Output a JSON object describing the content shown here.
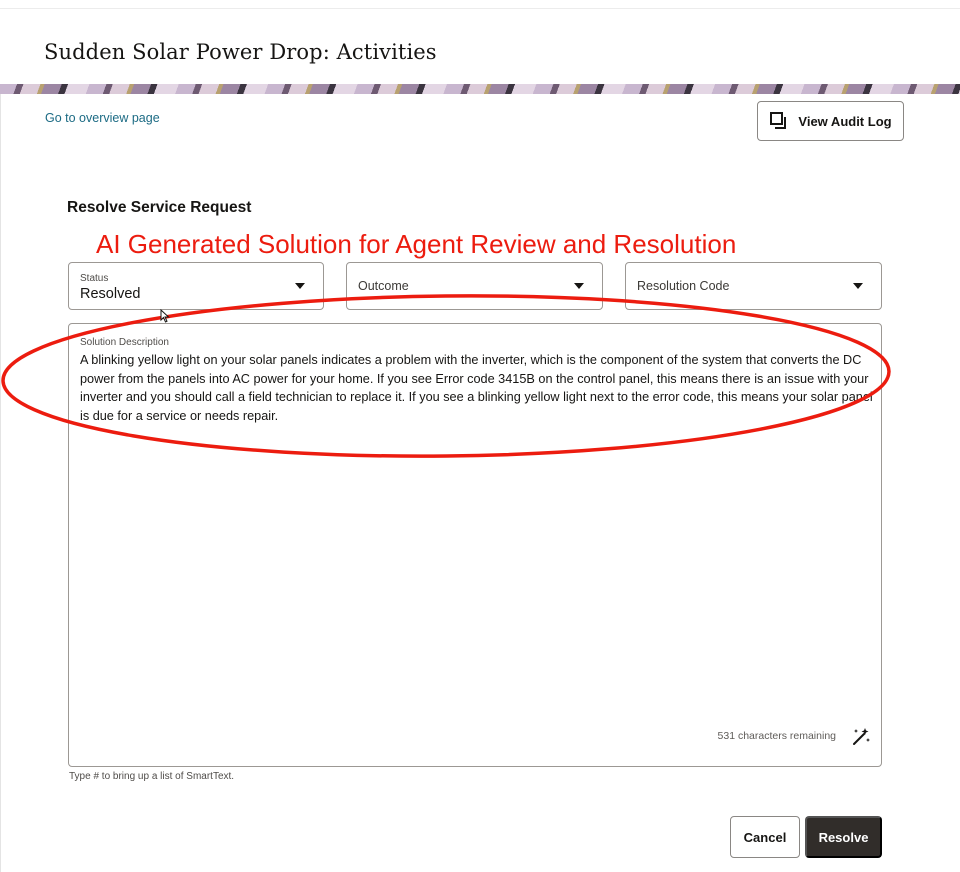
{
  "header": {
    "title": "Sudden Solar Power Drop: Activities"
  },
  "toolbar": {
    "overview_link": "Go to overview page",
    "audit_log_label": "View Audit Log"
  },
  "form": {
    "title": "Resolve Service Request",
    "annotation": "AI Generated Solution for Agent Review and Resolution",
    "status": {
      "label": "Status",
      "value": "Resolved"
    },
    "outcome": {
      "label": "Outcome"
    },
    "resolution_code": {
      "label": "Resolution Code"
    },
    "solution": {
      "label": "Solution Description",
      "text": "A blinking yellow light on your solar panels indicates a problem with the inverter, which is the component of the system that converts the DC power from the panels into AC power for your home. If you see Error code 3415B on the control panel, this means there is an issue with your inverter and you should call a field technician to replace it. If you see a blinking yellow light next to the error code, this means your solar panel is due for a service or needs repair.",
      "chars_remaining": "531 characters remaining"
    },
    "helper": "Type # to bring up a list of SmartText.",
    "cancel_label": "Cancel",
    "resolve_label": "Resolve"
  },
  "colors": {
    "annotation": "#ec1c0f",
    "link": "#1c6b84",
    "primary_button": "#312d2a"
  },
  "icons": {
    "audit": "copy-squares-icon",
    "ai_assist": "magic-wand-icon",
    "dropdown": "chevron-down-icon"
  }
}
